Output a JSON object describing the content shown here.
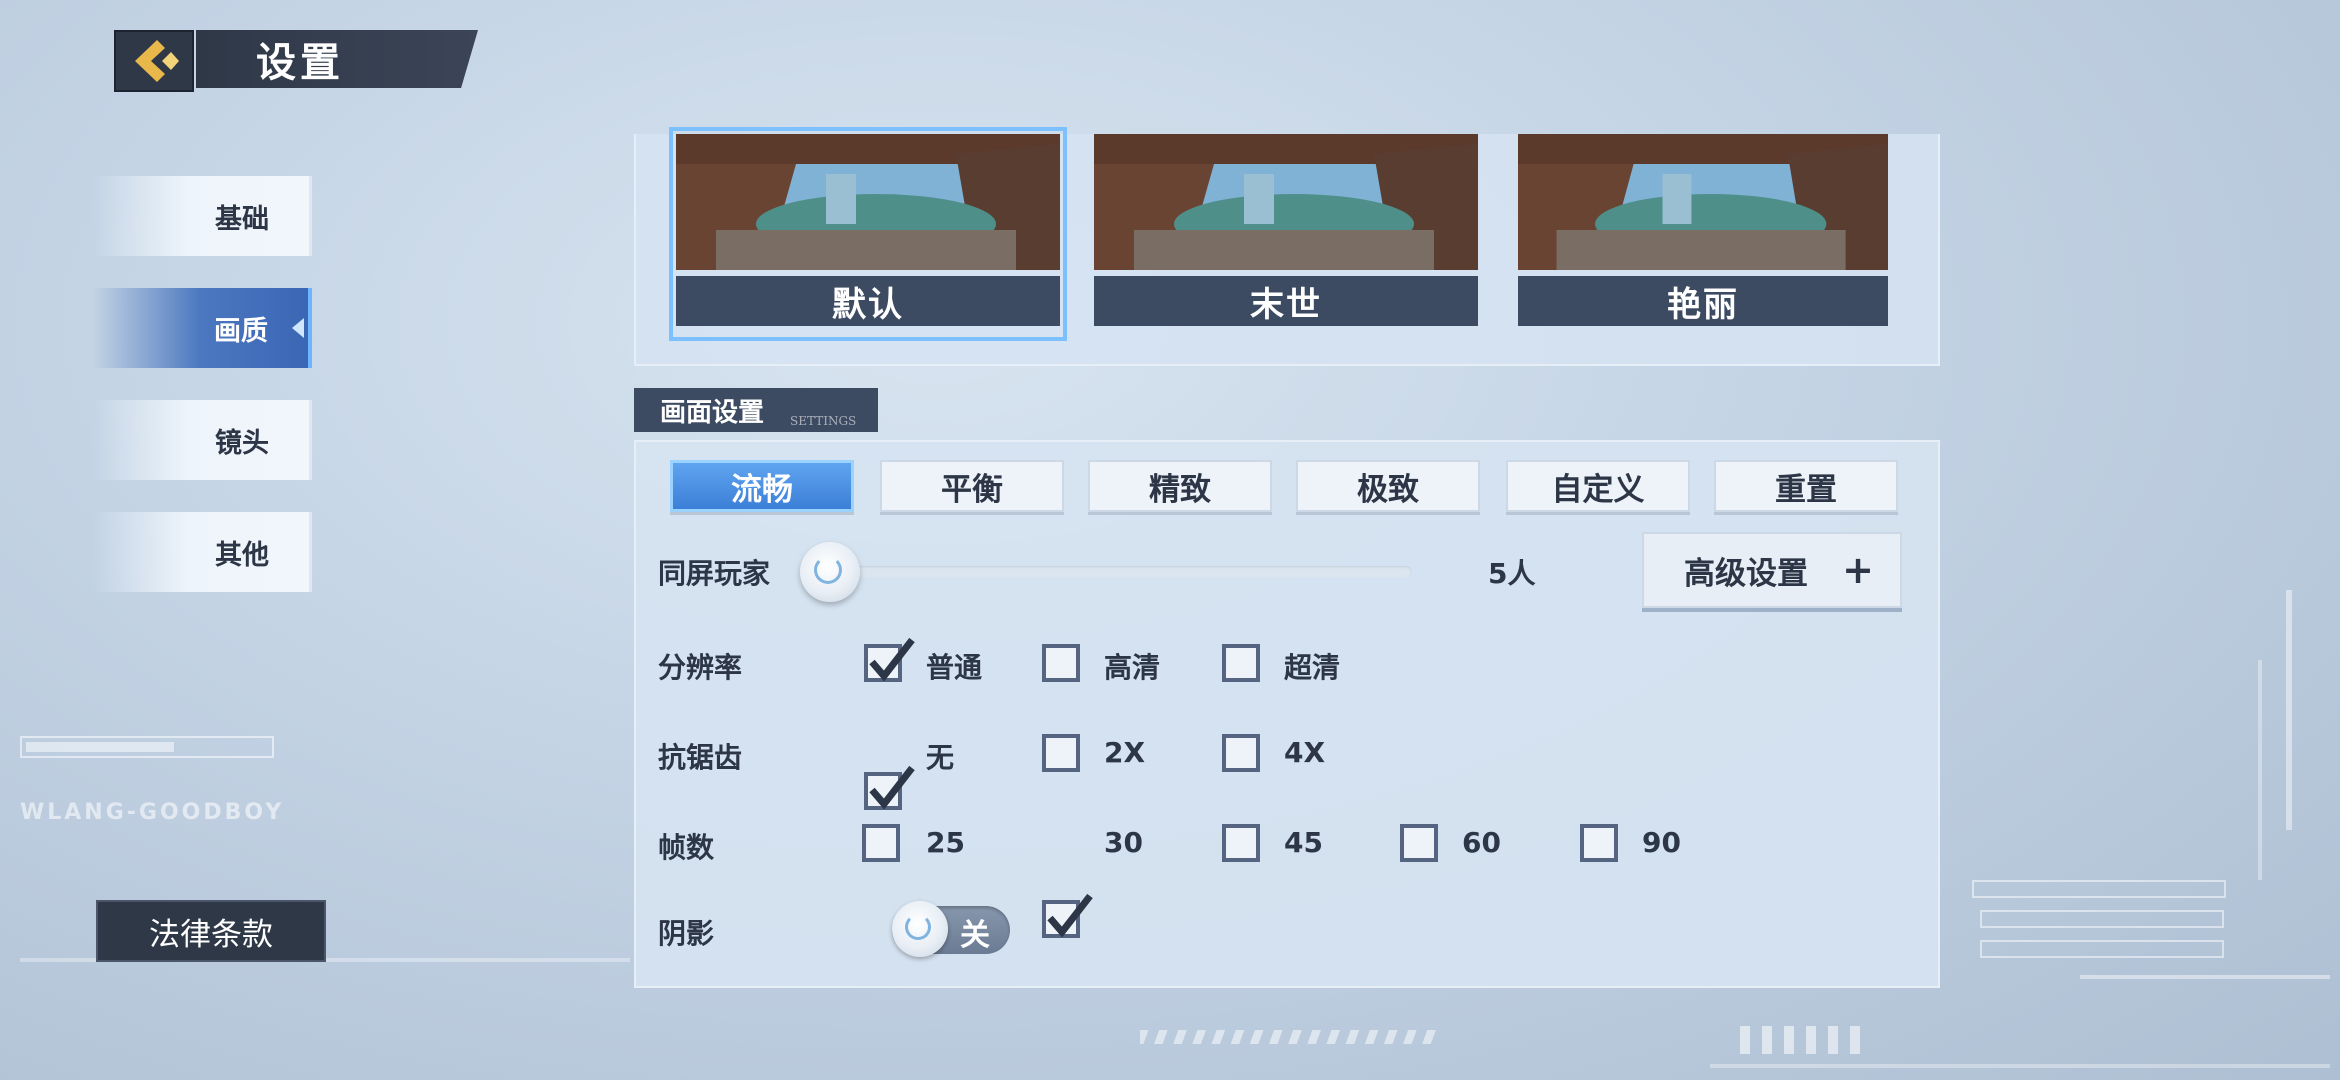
{
  "header": {
    "title": "设置",
    "back_icon": "back-arrow-icon"
  },
  "nav": {
    "items": [
      {
        "label": "基础",
        "active": false
      },
      {
        "label": "画质",
        "active": true
      },
      {
        "label": "镜头",
        "active": false
      },
      {
        "label": "其他",
        "active": false
      }
    ],
    "legal": "法律条款"
  },
  "decor": {
    "watermark": "WLANG-GOODBOY"
  },
  "presets": [
    {
      "label": "默认",
      "selected": true
    },
    {
      "label": "末世",
      "selected": false
    },
    {
      "label": "艳丽",
      "selected": false
    }
  ],
  "section": {
    "title": "画面设置",
    "subtitle": "SETTINGS"
  },
  "quality_levels": [
    {
      "label": "流畅",
      "active": true
    },
    {
      "label": "平衡",
      "active": false
    },
    {
      "label": "精致",
      "active": false
    },
    {
      "label": "极致",
      "active": false
    },
    {
      "label": "自定义",
      "active": false
    },
    {
      "label": "重置",
      "active": false
    }
  ],
  "players": {
    "label": "同屏玩家",
    "value": "5人",
    "level": 0
  },
  "advanced": {
    "label": "高级设置",
    "icon": "plus-icon"
  },
  "resolution": {
    "label": "分辨率",
    "options": [
      {
        "label": "普通",
        "checked": true
      },
      {
        "label": "高清",
        "checked": false
      },
      {
        "label": "超清",
        "checked": false
      }
    ]
  },
  "antialias": {
    "label": "抗锯齿",
    "options": [
      {
        "label": "无",
        "checked": true
      },
      {
        "label": "2X",
        "checked": false
      },
      {
        "label": "4X",
        "checked": false
      }
    ]
  },
  "fps": {
    "label": "帧数",
    "options": [
      {
        "label": "25",
        "checked": false
      },
      {
        "label": "30",
        "checked": true
      },
      {
        "label": "45",
        "checked": false
      },
      {
        "label": "60",
        "checked": false
      },
      {
        "label": "90",
        "checked": false
      }
    ]
  },
  "shadow": {
    "label": "阴影",
    "state": "关",
    "on": false
  },
  "colors": {
    "accent": "#3c7fd8",
    "dark": "#2f3847",
    "panel": "#d6e3f2"
  }
}
